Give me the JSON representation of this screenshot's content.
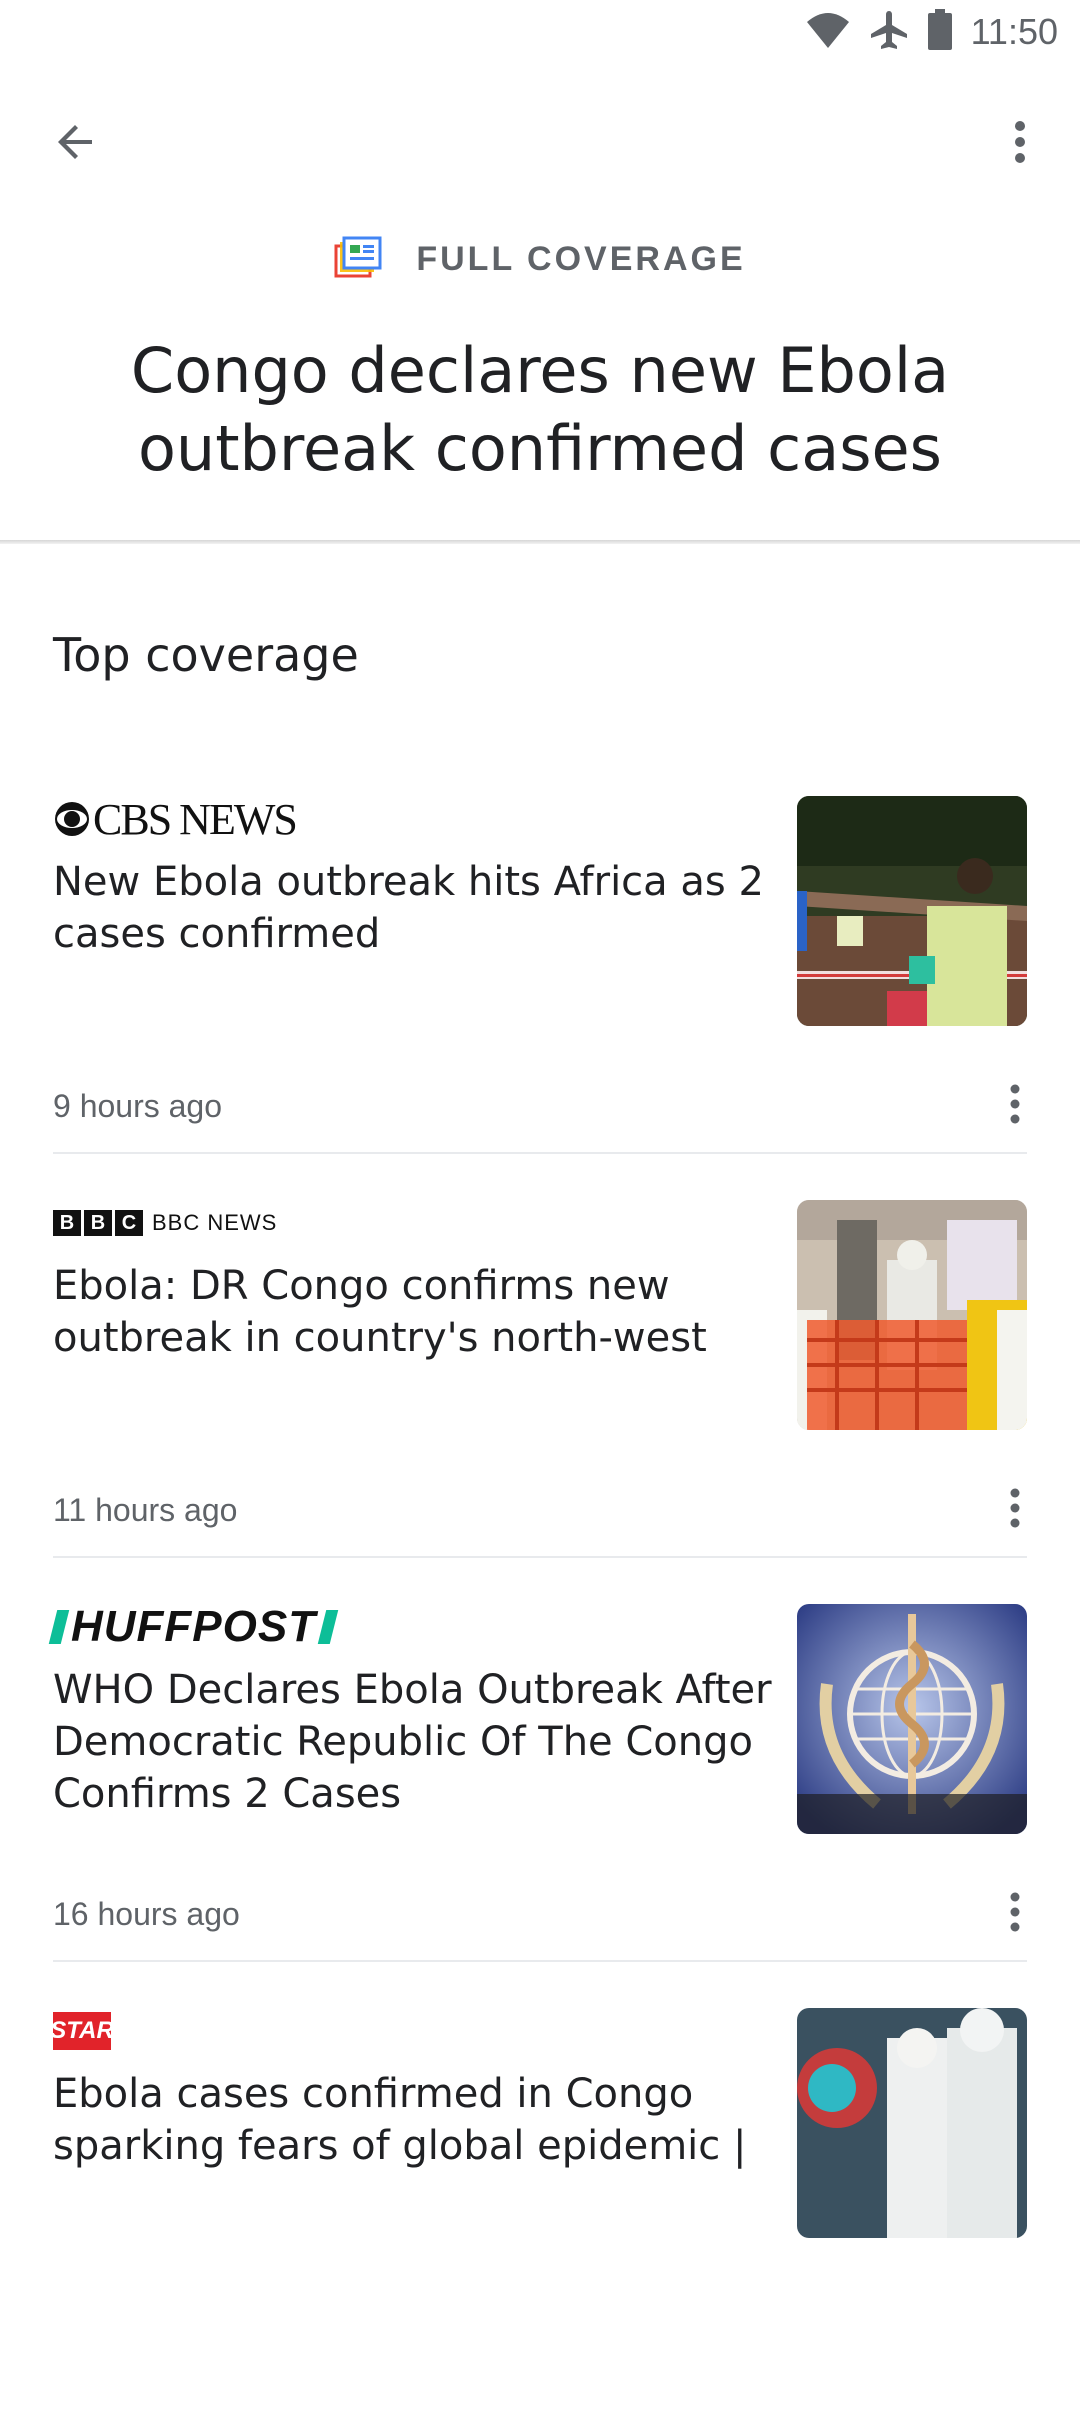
{
  "status_bar": {
    "time": "11:50",
    "icons": [
      "wifi-icon",
      "airplane-icon",
      "battery-icon"
    ]
  },
  "app_bar": {
    "back_icon": "arrow-back-icon",
    "more_icon": "more-vert-icon"
  },
  "header": {
    "label": "FULL COVERAGE",
    "title": "Congo declares new Ebola outbreak confirmed cases"
  },
  "section": {
    "title": "Top coverage"
  },
  "articles": [
    {
      "publisher": "CBS NEWS",
      "headline": "New Ebola outbreak hits Africa as 2 cases confirmed",
      "time": "9 hours ago"
    },
    {
      "publisher": "BBC NEWS",
      "headline": "Ebola: DR Congo confirms new outbreak in country's north-west",
      "time": "11 hours ago"
    },
    {
      "publisher": "HUFFPOST",
      "headline": "WHO Declares Ebola Outbreak After Democratic Republic Of The Congo Confirms 2 Cases",
      "time": "16 hours ago"
    },
    {
      "publisher": "STAR",
      "headline": "Ebola cases confirmed in Congo sparking fears of global epidemic |",
      "time": ""
    }
  ],
  "colors": {
    "text_primary": "#202124",
    "text_secondary": "#5f6368",
    "divider": "#e8eaed",
    "huffpost_green": "#0dbe98",
    "star_red": "#e1232a"
  }
}
